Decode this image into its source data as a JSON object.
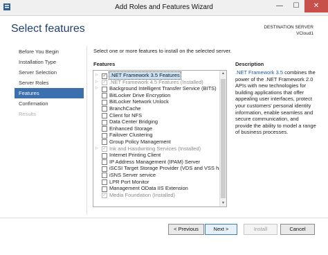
{
  "window": {
    "title": "Add Roles and Features Wizard",
    "controls": {
      "minimize": "—",
      "maximize": "☐",
      "close": "✕"
    }
  },
  "header": {
    "title": "Select features",
    "destination_label": "DESTINATION SERVER",
    "destination_value": "VCloud1"
  },
  "nav": {
    "items": [
      {
        "label": "Before You Begin",
        "state": "normal"
      },
      {
        "label": "Installation Type",
        "state": "normal"
      },
      {
        "label": "Server Selection",
        "state": "normal"
      },
      {
        "label": "Server Roles",
        "state": "normal"
      },
      {
        "label": "Features",
        "state": "active"
      },
      {
        "label": "Confirmation",
        "state": "normal"
      },
      {
        "label": "Results",
        "state": "disabled"
      }
    ]
  },
  "content": {
    "intro": "Select one or more features to install on the selected server.",
    "features_heading": "Features",
    "features": [
      {
        "label": ".NET Framework 3.5 Features",
        "checked": true,
        "expandable": true,
        "selected": true,
        "dim": false
      },
      {
        "label": ".NET Framework 4.5 Features (Installed)",
        "checked": true,
        "expandable": true,
        "selected": false,
        "dim": true
      },
      {
        "label": "Background Intelligent Transfer Service (BITS)",
        "checked": false,
        "expandable": true,
        "selected": false,
        "dim": false
      },
      {
        "label": "BitLocker Drive Encryption",
        "checked": false,
        "expandable": false,
        "selected": false,
        "dim": false
      },
      {
        "label": "BitLocker Network Unlock",
        "checked": false,
        "expandable": false,
        "selected": false,
        "dim": false
      },
      {
        "label": "BranchCache",
        "checked": false,
        "expandable": false,
        "selected": false,
        "dim": false
      },
      {
        "label": "Client for NFS",
        "checked": false,
        "expandable": false,
        "selected": false,
        "dim": false
      },
      {
        "label": "Data Center Bridging",
        "checked": false,
        "expandable": false,
        "selected": false,
        "dim": false
      },
      {
        "label": "Enhanced Storage",
        "checked": false,
        "expandable": false,
        "selected": false,
        "dim": false
      },
      {
        "label": "Failover Clustering",
        "checked": false,
        "expandable": false,
        "selected": false,
        "dim": false
      },
      {
        "label": "Group Policy Management",
        "checked": false,
        "expandable": false,
        "selected": false,
        "dim": false
      },
      {
        "label": "Ink and Handwriting Services (Installed)",
        "checked": true,
        "expandable": true,
        "selected": false,
        "dim": true
      },
      {
        "label": "Internet Printing Client",
        "checked": false,
        "expandable": false,
        "selected": false,
        "dim": false
      },
      {
        "label": "IP Address Management (IPAM) Server",
        "checked": false,
        "expandable": false,
        "selected": false,
        "dim": false
      },
      {
        "label": "iSCSI Target Storage Provider (VDS and VSS hard",
        "checked": false,
        "expandable": false,
        "selected": false,
        "dim": false
      },
      {
        "label": "iSNS Server service",
        "checked": false,
        "expandable": false,
        "selected": false,
        "dim": false
      },
      {
        "label": "LPR Port Monitor",
        "checked": false,
        "expandable": false,
        "selected": false,
        "dim": false
      },
      {
        "label": "Management OData IIS Extension",
        "checked": false,
        "expandable": false,
        "selected": false,
        "dim": false
      },
      {
        "label": "Media Foundation (Installed)",
        "checked": true,
        "expandable": false,
        "selected": false,
        "dim": true
      }
    ],
    "description_heading": "Description",
    "description_link": ".NET Framework 3.5",
    "description_body": "combines the power of the .NET Framework 2.0 APIs with new technologies for building applications that offer appealing user interfaces, protect your customers' personal identity information, enable seamless and secure communication, and provide the ability to model a range of business processes."
  },
  "footer": {
    "previous": "< Previous",
    "next": "Next >",
    "install": "Install",
    "cancel": "Cancel"
  },
  "colors": {
    "accent": "#3b6fad",
    "heading": "#1e3f6f",
    "close": "#c7504b"
  }
}
